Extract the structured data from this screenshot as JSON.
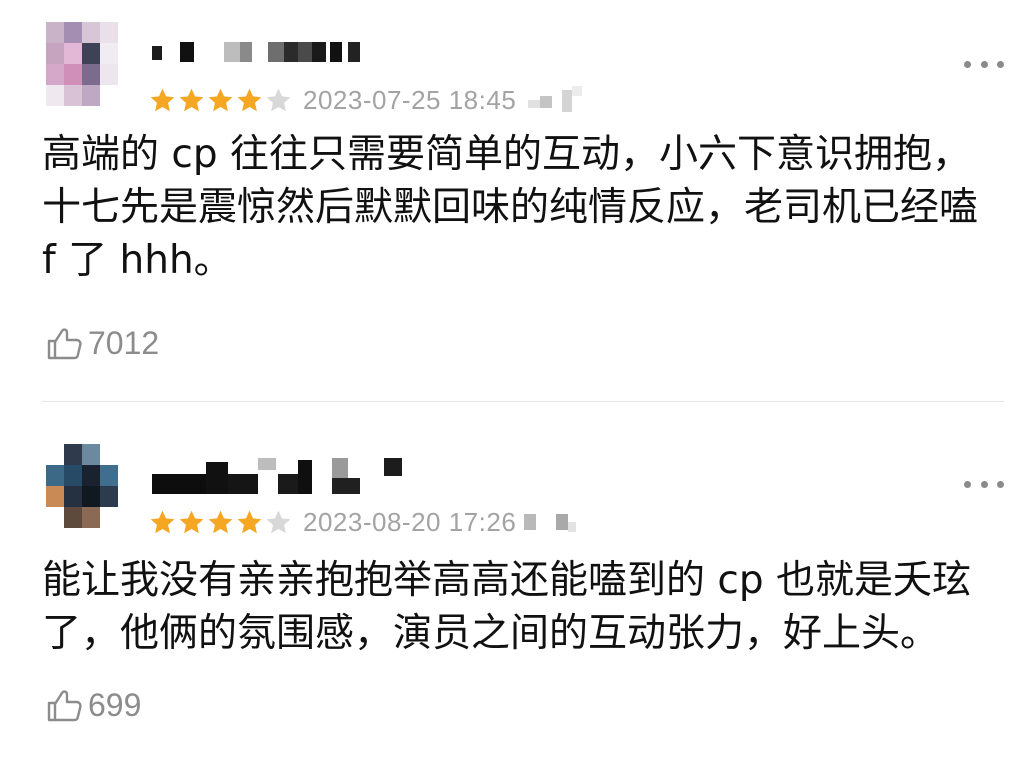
{
  "colors": {
    "star_filled": "#F5A623",
    "star_empty": "#D8D8D8",
    "timestamp_text": "#A3A3A3",
    "comment_text": "#111111",
    "like_text": "#8C8C8C",
    "divider": "#E6E6E6"
  },
  "icons": {
    "more": "more-horizontal-dots-icon",
    "star": "star-icon",
    "like": "thumbs-up-icon"
  },
  "reviews": [
    {
      "username": "",
      "rating": 4,
      "rating_max": 5,
      "timestamp": "2023-07-25 18:45",
      "comment": "高端的 cp 往往只需要简单的互动，小六下意识拥抱，十七先是震惊然后默默回味的纯情反应，老司机已经嗑 f 了 hhh。",
      "likes": "7012"
    },
    {
      "username": "",
      "rating": 4,
      "rating_max": 5,
      "timestamp": "2023-08-20 17:26",
      "comment": "能让我没有亲亲抱抱举高高还能嗑到的 cp 也就是夭玹了，他俩的氛围感，演员之间的互动张力，好上头。",
      "likes": "699"
    }
  ]
}
